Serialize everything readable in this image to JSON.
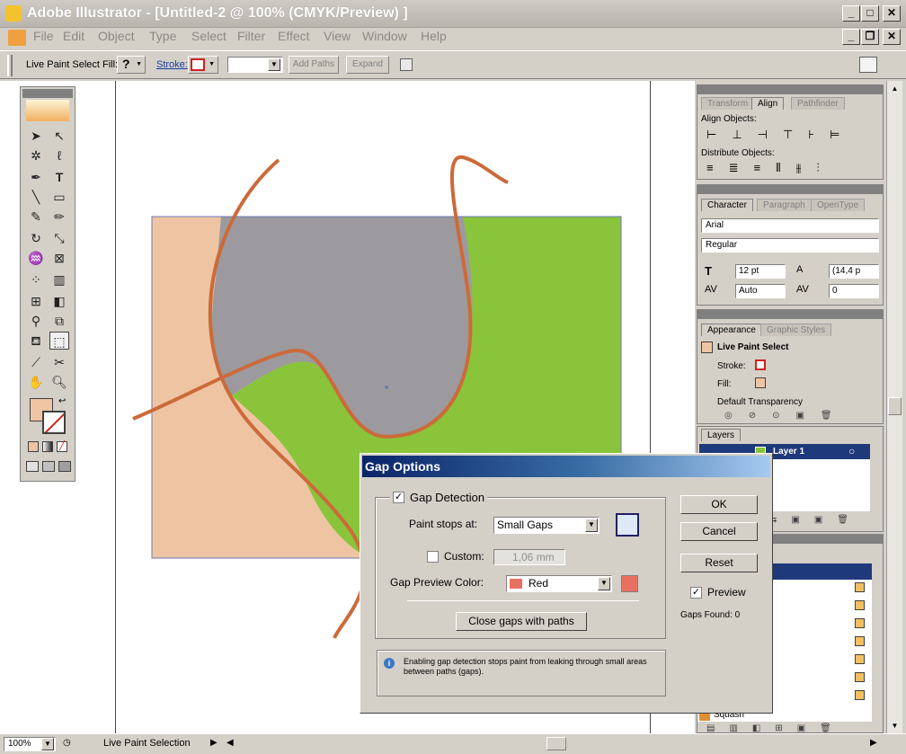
{
  "window": {
    "title": "Adobe Illustrator - [Untitled-2 @ 100% (CMYK/Preview) ]"
  },
  "menu": [
    "File",
    "Edit",
    "Object",
    "Type",
    "Select",
    "Filter",
    "Effect",
    "View",
    "Window",
    "Help"
  ],
  "control_bar": {
    "tool_name": "Live Paint Select",
    "fill_label": "Fill:",
    "fill_value": "?",
    "stroke_label": "Stroke:",
    "add_paths": "Add Paths",
    "expand": "Expand"
  },
  "align_panel": {
    "tabs": [
      "Transform",
      "Align",
      "Pathfinder"
    ],
    "align_objects": "Align Objects:",
    "distribute_objects": "Distribute Objects:"
  },
  "character_panel": {
    "tabs": [
      "Character",
      "Paragraph",
      "OpenType"
    ],
    "font": "Arial",
    "style": "Regular",
    "size": "12 pt",
    "leading": "(14,4 p",
    "kerning": "Auto",
    "tracking": "0"
  },
  "appearance_panel": {
    "tabs": [
      "Appearance",
      "Graphic Styles"
    ],
    "header": "Live Paint Select",
    "stroke": "Stroke:",
    "fill": "Fill:",
    "transparency": "Default Transparency"
  },
  "layers_panel": {
    "tab": "Layers",
    "layer_name": "Layer 1",
    "bottom_item": "Squash"
  },
  "dialog": {
    "title": "Gap Options",
    "gap_detection": "Gap Detection",
    "paint_stops_label": "Paint stops at:",
    "paint_stops_value": "Small Gaps",
    "custom_label": "Custom:",
    "custom_value": "1,06 mm",
    "gap_color_label": "Gap Preview Color:",
    "gap_color_value": "Red",
    "close_gaps": "Close gaps with paths",
    "info": "Enabling gap detection stops paint from leaking through small areas between paths (gaps).",
    "ok": "OK",
    "cancel": "Cancel",
    "reset": "Reset",
    "preview": "Preview",
    "gaps_found": "Gaps Found: 0"
  },
  "status_bar": {
    "zoom": "100%",
    "tool": "Live Paint Selection"
  },
  "colors": {
    "peach": "#eec4a2",
    "green": "#8ac43a",
    "gray": "#9c9a9e",
    "stroke": "#cc6a3a",
    "gap_red": "#e87060"
  }
}
